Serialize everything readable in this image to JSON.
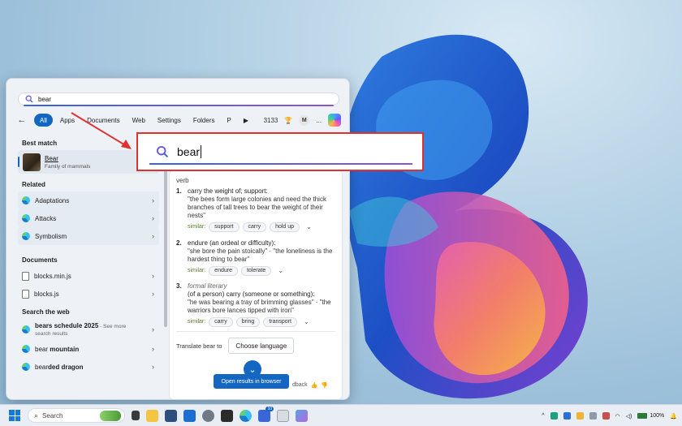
{
  "search": {
    "query": "bear"
  },
  "filters": {
    "items": [
      "All",
      "Apps",
      "Documents",
      "Web",
      "Settings",
      "Folders",
      "P"
    ],
    "count": "3133",
    "avatar": "M",
    "more": "..."
  },
  "best_match": {
    "title": "Best match",
    "name": "Bear",
    "subtitle": "Family of mammals"
  },
  "related": {
    "title": "Related",
    "items": [
      "Adaptations",
      "Attacks",
      "Symbolism"
    ]
  },
  "documents": {
    "title": "Documents",
    "items": [
      "blocks.min.js",
      "blocks.js"
    ]
  },
  "web": {
    "title": "Search the web",
    "items": [
      {
        "bold": "bears",
        "rest": " schedule 2025",
        "extra": " - See more",
        "sub": "search results"
      },
      {
        "bold": "bear",
        "rest": " mountain",
        "extra": "",
        "sub": ""
      },
      {
        "bold": "bear",
        "rest": "ded dragon",
        "extra": "",
        "sub": ""
      }
    ]
  },
  "definition": {
    "pos": "verb",
    "senses": [
      {
        "num": "1.",
        "meaning": "carry the weight of; support:",
        "example": "\"the bees form large colonies and need the thick branches of tall trees to bear the weight of their nests\"",
        "label": "",
        "similar_label": "similar:",
        "similar": [
          "support",
          "carry",
          "hold up"
        ]
      },
      {
        "num": "2.",
        "meaning": "endure (an ordeal or difficulty):",
        "example": "\"she bore the pain stoically\" · \"the loneliness is the hardest thing to bear\"",
        "label": "",
        "similar_label": "similar:",
        "similar": [
          "endure",
          "tolerate"
        ]
      },
      {
        "num": "3.",
        "meaning": "(of a person) carry (someone or something):",
        "example": "\"he was bearing a tray of brimming glasses\" · \"the warriors bore lances tipped with iron\"",
        "label": "formal literary",
        "similar_label": "similar:",
        "similar": [
          "carry",
          "bring",
          "transport"
        ]
      }
    ],
    "translate_label": "Translate bear to",
    "choose_language": "Choose language",
    "open_results": "Open results in browser",
    "feedback": "dback"
  },
  "taskbar": {
    "search_label": "Search",
    "badge": "10",
    "battery": "100%"
  },
  "colors": {
    "accent": "#1467c0",
    "callout_border": "#e03131",
    "arrow": "#e03131"
  }
}
